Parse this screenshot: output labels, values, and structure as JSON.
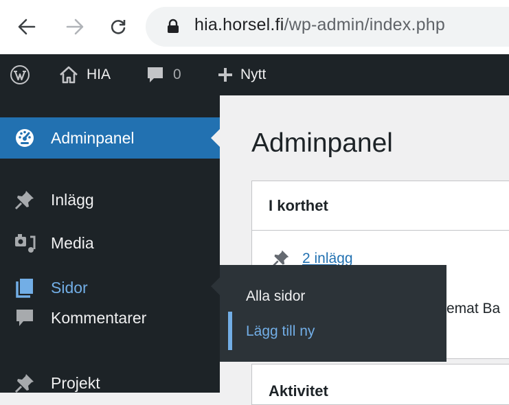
{
  "browser": {
    "url_host": "hia.horsel.fi",
    "url_path": "/wp-admin/index.php"
  },
  "adminbar": {
    "site_name": "HIA",
    "comments_count": "0",
    "new_label": "Nytt"
  },
  "sidebar": {
    "items": [
      {
        "label": "Adminpanel",
        "icon": "dashboard-icon",
        "active": true
      },
      {
        "label": "Inlägg",
        "icon": "pin-icon"
      },
      {
        "label": "Media",
        "icon": "media-icon"
      },
      {
        "label": "Sidor",
        "icon": "pages-icon",
        "hover": true
      },
      {
        "label": "Kommentarer",
        "icon": "comment-icon"
      },
      {
        "label": "Projekt",
        "icon": "pin-icon"
      }
    ]
  },
  "main": {
    "title": "Adminpanel",
    "glance": {
      "heading": "I korthet",
      "posts_link": "2 inlägg",
      "theme_fragment": "emat Ba"
    },
    "activity_heading": "Aktivitet"
  },
  "flyout": {
    "items": [
      {
        "label": "Alla sidor"
      },
      {
        "label": "Lägg till ny",
        "current": true
      }
    ]
  },
  "colors": {
    "accent": "#2271b1",
    "adminbar_bg": "#1d2327",
    "flyout_bg": "#2c3338",
    "highlight": "#72aee6"
  }
}
